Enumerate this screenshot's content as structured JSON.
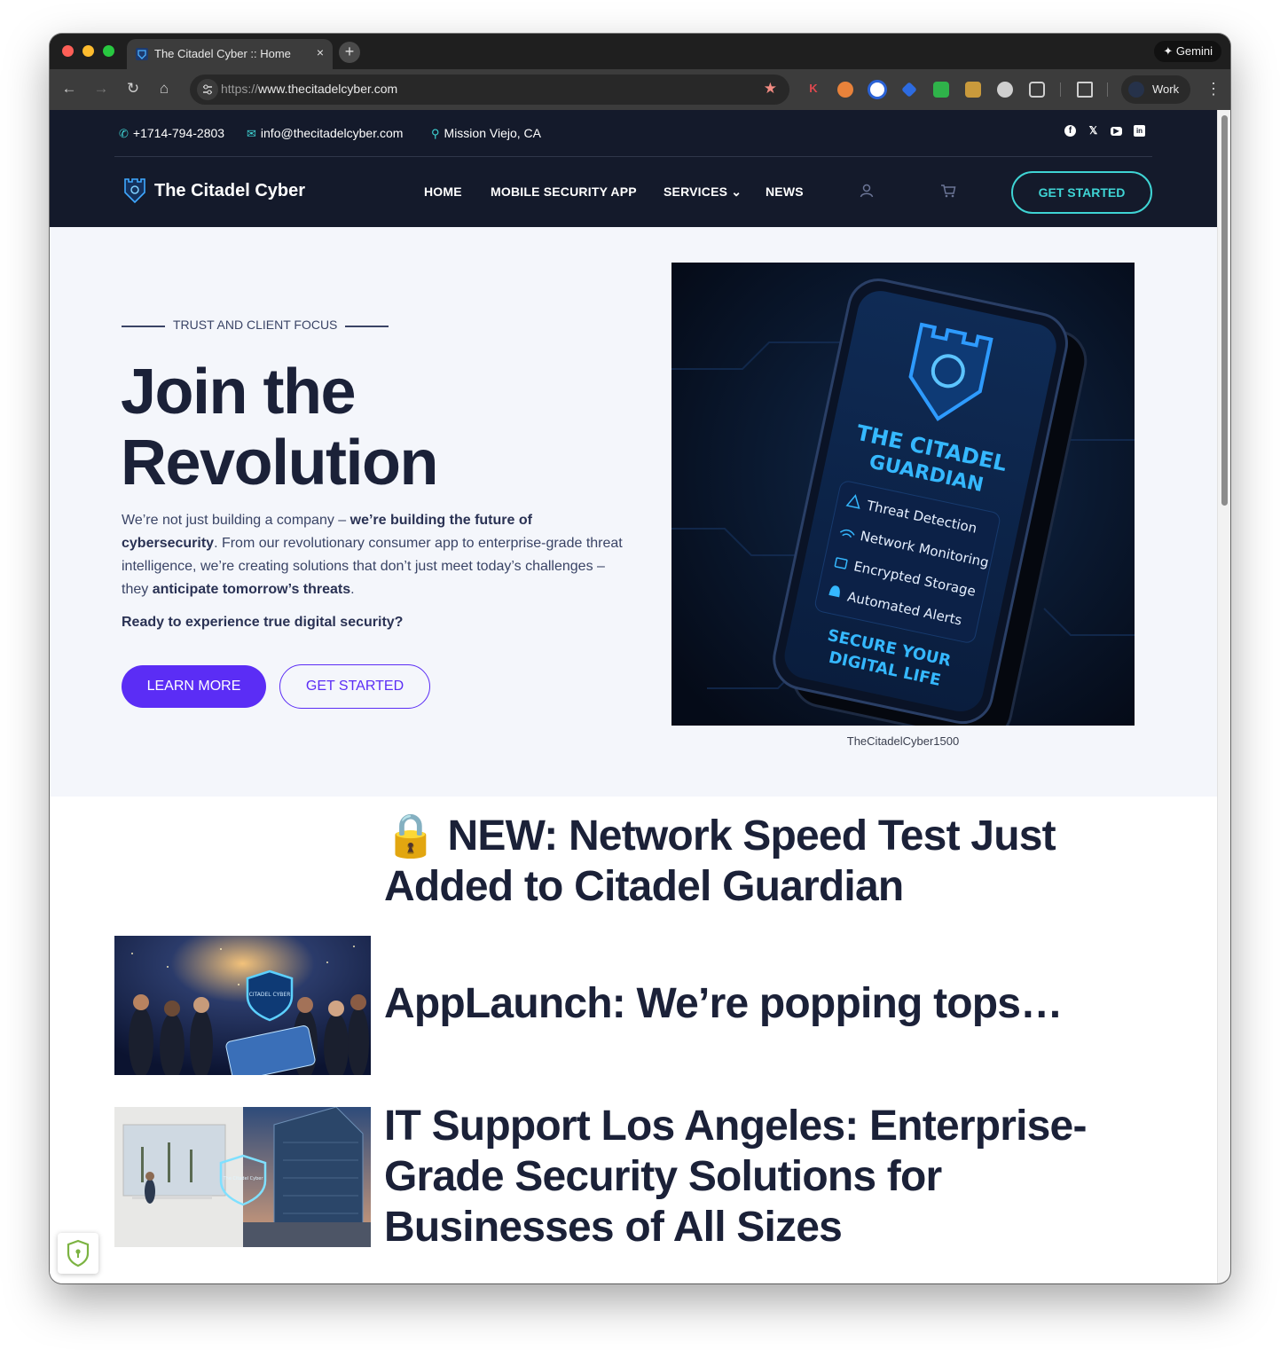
{
  "browser": {
    "tab_title": "The Citadel Cyber :: Home",
    "tab_close": "×",
    "new_tab": "+",
    "gemini_label": "✦ Gemini",
    "url_scheme": "https://",
    "url_host": "www.thecitadelcyber.com",
    "profile_label": "Work",
    "back": "←",
    "forward": "→",
    "reload": "↻",
    "home": "⌂",
    "bookmark_star": "★",
    "menu": "⋮"
  },
  "topbar": {
    "phone": "+1714-794-2803",
    "email": "info@thecitadelcyber.com",
    "location": "Mission Viejo, CA",
    "socials": [
      "f",
      "𝕏",
      "▶",
      "in"
    ]
  },
  "header": {
    "logo_text": "The Citadel Cyber",
    "nav": [
      "HOME",
      "MOBILE SECURITY APP",
      "SERVICES ⌄",
      "NEWS"
    ],
    "cta": "GET STARTED"
  },
  "hero": {
    "kicker": "TRUST AND CLIENT FOCUS",
    "title_line1": "Join the",
    "title_line2": "Revolution",
    "body_1": "We’re not just building a company – ",
    "body_bold_1": "we’re building the future of cybersecurity",
    "body_2": ". From our revolutionary consumer app to enterprise-grade threat intelligence, we’re creating solutions that don’t just meet today’s challenges – they ",
    "body_bold_2": "anticipate tomorrow’s threats",
    "body_3": ".",
    "ready": "Ready to experience true digital security?",
    "learn_more": "LEARN MORE",
    "get_started": "GET STARTED",
    "image_caption": "TheCitadelCyber1500",
    "phone_screen": {
      "title_1": "THE CITADEL",
      "title_2": "GUARDIAN",
      "features": [
        "Threat Detection",
        "Network Monitoring",
        "Encrypted Storage",
        "Automated Alerts"
      ],
      "tagline_1": "SECURE YOUR",
      "tagline_2": "DIGITAL LIFE"
    }
  },
  "news": {
    "items": [
      {
        "title_1": "🔒 NEW: Network Speed Test Just",
        "title_2": "Added to Citadel Guardian"
      },
      {
        "title_1": "AppLaunch: We’re popping tops…"
      },
      {
        "title_1": "IT Support Los Angeles: Enterprise-",
        "title_2": "Grade Security Solutions for",
        "title_3": "Businesses of All Sizes"
      }
    ],
    "thumb_1_shield_text": "CITADEL CYBER",
    "thumb_2_shield_text": "The Citadel Cyber"
  },
  "colors": {
    "header_bg": "#141a2b",
    "accent_teal": "#3fd4d4",
    "accent_purple": "#5b2df5",
    "heading": "#1b2138"
  }
}
